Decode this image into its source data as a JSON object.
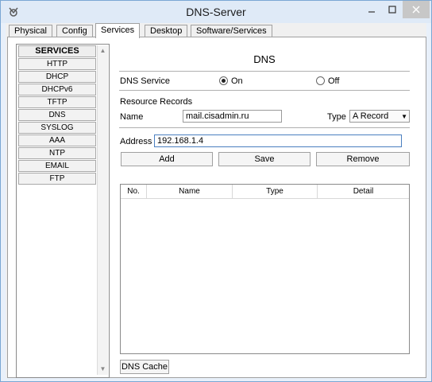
{
  "window": {
    "title": "DNS-Server"
  },
  "tabs": [
    "Physical",
    "Config",
    "Services",
    "Desktop",
    "Software/Services"
  ],
  "services": {
    "header": "SERVICES",
    "items": [
      "HTTP",
      "DHCP",
      "DHCPv6",
      "TFTP",
      "DNS",
      "SYSLOG",
      "AAA",
      "NTP",
      "EMAIL",
      "FTP"
    ]
  },
  "dns": {
    "title": "DNS",
    "service_label": "DNS Service",
    "on_label": "On",
    "off_label": "Off",
    "service_state": "On",
    "resource_records_label": "Resource Records",
    "name_label": "Name",
    "name_value": "mail.cisadmin.ru",
    "type_label": "Type",
    "type_value": "A Record",
    "address_label": "Address",
    "address_value": "192.168.1.4",
    "add_label": "Add",
    "save_label": "Save",
    "remove_label": "Remove",
    "columns": [
      "No.",
      "Name",
      "Type",
      "Detail"
    ],
    "cache_label": "DNS Cache"
  },
  "icons": {
    "app": "packet-tracer-icon",
    "minimize": "minimize-icon",
    "maximize": "maximize-icon",
    "close": "close-icon"
  }
}
